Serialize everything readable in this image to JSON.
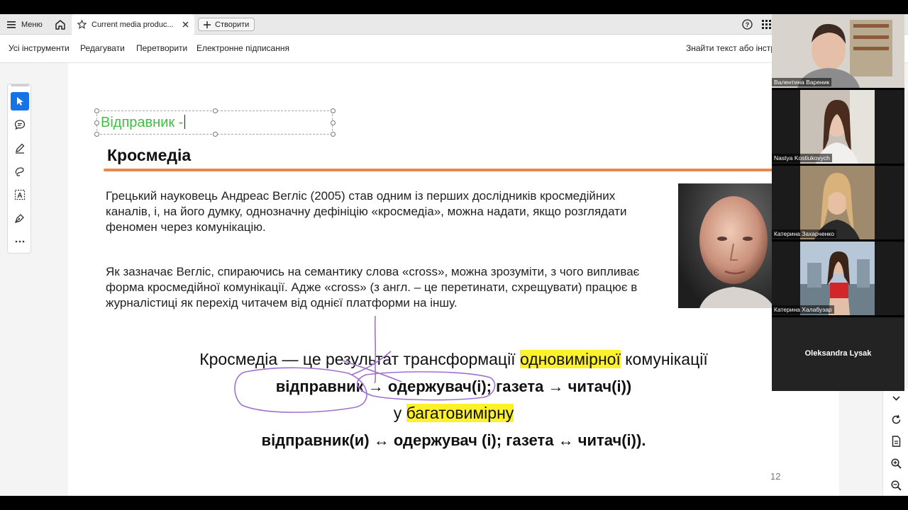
{
  "browser": {
    "menu_label": "Меню",
    "tab_title": "Current media produc...",
    "create_label": "Створити"
  },
  "toolbar": {
    "items": [
      "Усі інструменти",
      "Редагувати",
      "Перетворити",
      "Електронне підписання"
    ],
    "find_text": "Знайти текст або інстру"
  },
  "slide": {
    "annotation_text": "Відправник -",
    "title": "Кросмедіа",
    "para1": "Грецький науковець Андреас Вегліс (2005) став одним із перших дослідників кросмедійних каналів, і, на його думку, однозначну дефініцію «кросмедіа», можна надати, якщо розглядати феномен через комунікацію.",
    "para2": "Як зазначає Вегліс, спираючись на семантику слова «cross», можна зрозуміти, з чого випливає форма кросмедійної комунікації. Адже «cross» (з англ. – це перетинати, схрещувати) працює в журналістиці як перехід читачем від однієї платформи на іншу.",
    "line1_a": "Кросмедіа — це   результат трансформації ",
    "line1_hl": "одновимірної",
    "line1_b": " комунікації",
    "line2": "відправник → одержувач(і); газета → читач(і))",
    "line3_a": "у ",
    "line3_hl": "багатовимірну",
    "line4": "відправник(и) ↔ одержувач (і); газета ↔ читач(і)).",
    "page_number": "12",
    "highlight_color": "#fdf12a",
    "ink_color": "#a070d0"
  },
  "participants": [
    {
      "name": "Валентина Вареник"
    },
    {
      "name": "Nastya Kostiukovych"
    },
    {
      "name": "Катерина Захарченко"
    },
    {
      "name": "Катерина Халабузар"
    },
    {
      "name": "Oleksandra Lysak"
    }
  ]
}
